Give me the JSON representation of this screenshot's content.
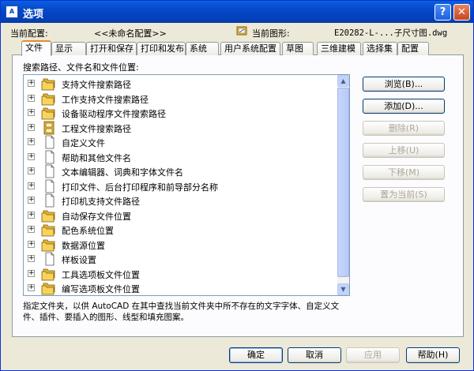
{
  "window": {
    "title": "选项",
    "app_icon": "autocad-app-icon"
  },
  "header": {
    "profile_label": "当前配置:",
    "profile_value": "<<未命名配置>>",
    "drawing_label": "当前图形:",
    "drawing_value": "E20282-L-...子尺寸图.dwg"
  },
  "tabs": [
    "文件",
    "显示",
    "打开和保存",
    "打印和发布",
    "系统",
    "用户系统配置",
    "草图",
    "三维建模",
    "选择集",
    "配置"
  ],
  "tree": {
    "caption": "搜索路径、文件名和文件位置:",
    "items": [
      {
        "label": "支持文件搜索路径",
        "icon": "folders-icon"
      },
      {
        "label": "工作支持文件搜索路径",
        "icon": "folders-icon"
      },
      {
        "label": "设备驱动程序文件搜索路径",
        "icon": "folders-icon"
      },
      {
        "label": "工程文件搜索路径",
        "icon": "file-cabinet-icon"
      },
      {
        "label": "自定义文件",
        "icon": "document-icon"
      },
      {
        "label": "帮助和其他文件名",
        "icon": "document-icon"
      },
      {
        "label": "文本编辑器、词典和字体文件名",
        "icon": "document-icon"
      },
      {
        "label": "打印文件、后台打印程序和前导部分名称",
        "icon": "document-icon"
      },
      {
        "label": "打印机支持文件路径",
        "icon": "document-icon"
      },
      {
        "label": "自动保存文件位置",
        "icon": "folders-icon"
      },
      {
        "label": "配色系统位置",
        "icon": "folders-icon"
      },
      {
        "label": "数据源位置",
        "icon": "folders-icon"
      },
      {
        "label": "样板设置",
        "icon": "document-icon"
      },
      {
        "label": "工具选项板文件位置",
        "icon": "folders-icon"
      },
      {
        "label": "编写选项板文件位置",
        "icon": "folders-icon"
      }
    ]
  },
  "description": "指定文件夹，以供 AutoCAD 在其中查找当前文件夹中所不存在的文字字体、自定义文件、插件、要插入的图形、线型和填充图案。",
  "side_buttons": [
    {
      "label": "浏览(B)...",
      "enabled": true
    },
    {
      "label": "添加(D)...",
      "enabled": true
    },
    {
      "label": "删除(R)",
      "enabled": false
    },
    {
      "label": "上移(U)",
      "enabled": false
    },
    {
      "label": "下移(M)",
      "enabled": false
    },
    {
      "label": "置为当前(S)",
      "enabled": false
    }
  ],
  "footer": {
    "ok": "确定",
    "cancel": "取消",
    "apply": "应用",
    "help": "帮助(H)"
  },
  "colors": {
    "titlebar": "#0a5fe0",
    "tab_highlight": "#e68b2c",
    "folder": "#f7d35a"
  }
}
